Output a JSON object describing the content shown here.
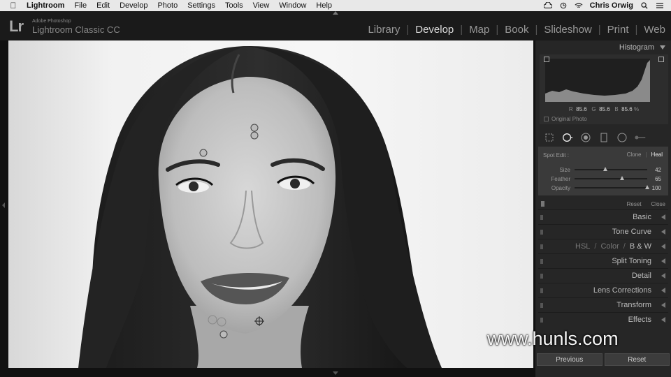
{
  "menubar": {
    "app": "Lightroom",
    "items": [
      "File",
      "Edit",
      "Develop",
      "Photo",
      "Settings",
      "Tools",
      "View",
      "Window",
      "Help"
    ],
    "user": "Chris Orwig"
  },
  "header": {
    "logo": "Lr",
    "brand_top": "Adobe Photoshop",
    "brand_name": "Lightroom Classic CC",
    "modules": [
      "Library",
      "Develop",
      "Map",
      "Book",
      "Slideshow",
      "Print",
      "Web"
    ],
    "active_module": "Develop"
  },
  "histogram": {
    "title": "Histogram",
    "r_label": "R",
    "r_value": "85.6",
    "g_label": "G",
    "g_value": "85.6",
    "b_label": "B",
    "b_value": "85.6",
    "unit": "%",
    "original_photo": "Original Photo"
  },
  "spot_edit": {
    "label": "Spot Edit :",
    "mode_clone": "Clone",
    "mode_heal": "Heal",
    "active_mode": "Heal",
    "sliders": [
      {
        "label": "Size",
        "value": "42",
        "fraction": 0.42
      },
      {
        "label": "Feather",
        "value": "65",
        "fraction": 0.65
      },
      {
        "label": "Opacity",
        "value": "100",
        "fraction": 1.0
      }
    ],
    "reset": "Reset",
    "close": "Close"
  },
  "panels": [
    {
      "label": "Basic"
    },
    {
      "label": "Tone Curve"
    },
    {
      "label": "HSL / Color / B & W",
      "parts": [
        "HSL",
        "Color",
        "B & W"
      ]
    },
    {
      "label": "Split Toning"
    },
    {
      "label": "Detail"
    },
    {
      "label": "Lens Corrections"
    },
    {
      "label": "Transform"
    },
    {
      "label": "Effects"
    }
  ],
  "buttons": {
    "previous": "Previous",
    "reset": "Reset"
  },
  "watermark": "www.hunls.com",
  "colors": {
    "panel_bg": "#262626",
    "active_text": "#dddddd",
    "dim_text": "#999999"
  }
}
